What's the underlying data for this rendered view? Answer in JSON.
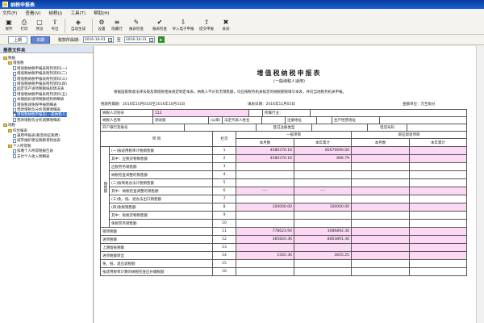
{
  "window": {
    "title": "纳税申报表"
  },
  "menu": [
    "文件(F)",
    "查看(V)",
    "纳税(J)",
    "工具(T)",
    "帮助(H)"
  ],
  "toolbar": [
    {
      "label": "保存",
      "icon": "save-icon",
      "glyph": "▣"
    },
    {
      "label": "打印",
      "icon": "print-icon",
      "glyph": "⎙"
    },
    {
      "label": "预览",
      "icon": "preview-icon",
      "glyph": "▢"
    },
    {
      "label": "导出",
      "icon": "export-icon",
      "glyph": "⇪"
    },
    {
      "label": "自动生成",
      "icon": "auto-generate-icon",
      "glyph": "◈",
      "wide": true
    },
    {
      "label": "设置",
      "icon": "settings-icon",
      "glyph": "⚙"
    },
    {
      "label": "隐藏行",
      "icon": "hide-rows-icon",
      "glyph": "≡"
    },
    {
      "label": "报表检查",
      "icon": "report-check-icon",
      "glyph": "✎",
      "wide": true
    },
    {
      "label": "报表检查",
      "icon": "report-check-2-icon",
      "glyph": "✔",
      "wide": true
    },
    {
      "label": "导入电子申报",
      "icon": "import-icon",
      "glyph": "⇩",
      "wide": true
    },
    {
      "label": "提交申报",
      "icon": "submit-icon",
      "glyph": "⇧",
      "wide": true
    },
    {
      "label": "关闭",
      "icon": "close-icon",
      "glyph": "✖"
    }
  ],
  "datebar": {
    "prev": "上期",
    "current": "本期",
    "period_label": "税款所属期:",
    "start": "2016-10-01",
    "sep": "至",
    "end": "2016-10-31"
  },
  "sidebar": {
    "header": "报表文件夹",
    "items": [
      {
        "label": "税报",
        "level": 0,
        "type": "folder"
      },
      {
        "label": "增值税",
        "level": 1,
        "type": "folder"
      },
      {
        "label": "增值税纳税申报表附列资料(一)",
        "level": 2,
        "type": "doc"
      },
      {
        "label": "增值税纳税申报表附列资料(二)",
        "level": 2,
        "type": "doc"
      },
      {
        "label": "增值税纳税申报表附列资料(三)",
        "level": 2,
        "type": "doc"
      },
      {
        "label": "增值税纳税申报表附列资料(四)",
        "level": 2,
        "type": "doc"
      },
      {
        "label": "固定资产进项税额抵扣情况表",
        "level": 2,
        "type": "doc"
      },
      {
        "label": "增值税纳税申报表附列资料(五)",
        "level": 2,
        "type": "doc"
      },
      {
        "label": "本期抵扣进项税额结构明细表",
        "level": 2,
        "type": "doc"
      },
      {
        "label": "增值税减免税申报明细表",
        "level": 2,
        "type": "doc"
      },
      {
        "label": "营改增税负分析测算明细表",
        "level": 2,
        "type": "doc"
      },
      {
        "label": "增值税纳税申报表(一般纳税人)",
        "level": 2,
        "type": "doc",
        "selected": true
      },
      {
        "label": "营改增税负分析测算明细表",
        "level": 2,
        "type": "doc"
      },
      {
        "label": "地税",
        "level": 0,
        "type": "folder"
      },
      {
        "label": "综合报表",
        "level": 1,
        "type": "folder"
      },
      {
        "label": "通用申报表(税及附征税费)",
        "level": 2,
        "type": "doc"
      },
      {
        "label": "城市维护建设税教育附加表",
        "level": 2,
        "type": "doc"
      },
      {
        "label": "个人所得税",
        "level": 1,
        "type": "folder"
      },
      {
        "label": "扣缴个人所得税报告表",
        "level": 2,
        "type": "doc"
      },
      {
        "label": "支付个人收入明细表",
        "level": 2,
        "type": "doc"
      }
    ]
  },
  "form": {
    "title": "增值税纳税申报表",
    "subtitle": "(一般纳税人适用)",
    "note": "根据国家税收法律法规及增值税相关规定制定本表。纳税人不论有无销售额，均应按税务机关核定的纳税期限填写本表，并向当地税务机关申报。",
    "period": "税款所属期：2016年10月01日至2016年10月31日",
    "fill_date": "填表日期：2016年11月05日",
    "unit": "金额单位：元至角分",
    "taxpayer_id_label": "纳税人识别号",
    "taxpayer_id": "112",
    "industry_label": "所属行业：",
    "name_label": "纳税人名称",
    "name": "测试版",
    "seal": "(公章)",
    "legal_label": "法定代表人姓名",
    "reg_addr_label": "注册地址",
    "prod_addr_label": "生产经营地址",
    "bank_label": "开户银行及账号",
    "reg_type_label": "登记注册类型",
    "phone_label": "电话号码",
    "item_header": "项 目",
    "col_header": "栏次",
    "general_header": "一般项目",
    "immediate_header": "即征即退项目",
    "this_month": "本月数",
    "ytd": "本年累计",
    "section_label": "销售额",
    "rows": [
      {
        "item": "(一)按适用税率计税销售额",
        "col": "1",
        "v1": "4580376.16",
        "v2": "85670690.00",
        "v3": "",
        "v4": ""
      },
      {
        "item": "其中：应税货物销售额",
        "col": "2",
        "v1": "4580376.16",
        "v2": "896.79",
        "v3": "",
        "v4": ""
      },
      {
        "item": "应税劳务销售额",
        "col": "3",
        "v1": "",
        "v2": "",
        "v3": "",
        "v4": ""
      },
      {
        "item": "纳税检查调整的销售额",
        "col": "4",
        "v1": "",
        "v2": "",
        "v3": "",
        "v4": ""
      },
      {
        "item": "(二)按简易办法计税销售额",
        "col": "5",
        "v1": "",
        "v2": "",
        "v3": "",
        "v4": ""
      },
      {
        "item": "其中：纳税检查调整的销售额",
        "col": "6",
        "v1": "----",
        "v2": "----",
        "v3": "",
        "v4": ""
      },
      {
        "item": "(三)免、抵、退办法出口销售额",
        "col": "7",
        "v1": "",
        "v2": "",
        "v3": "",
        "v4": ""
      },
      {
        "item": "(四)免税销售额",
        "col": "8",
        "v1": "100000.00",
        "v2": "100000.00",
        "v3": "",
        "v4": ""
      },
      {
        "item": "其中：免税货物销售额",
        "col": "9",
        "v1": "",
        "v2": "",
        "v3": "",
        "v4": ""
      },
      {
        "item": "免税劳务销售额",
        "col": "10",
        "v1": "",
        "v2": "",
        "v3": "",
        "v4": ""
      },
      {
        "item": "销项税额",
        "col": "11",
        "v1": "778623.94",
        "v2": "3086892.36",
        "v3": "",
        "v4": ""
      },
      {
        "item": "进项税额",
        "col": "12",
        "v1": "385820.36",
        "v2": "8663891.36",
        "v3": "",
        "v4": ""
      },
      {
        "item": "上期留抵税额",
        "col": "13",
        "v1": "",
        "v2": "",
        "v3": "",
        "v4": ""
      },
      {
        "item": "进项税额转出",
        "col": "14",
        "v1": "1565.36",
        "v2": "3655.25",
        "v3": "",
        "v4": ""
      },
      {
        "item": "免、抵、退应退税额",
        "col": "15",
        "v1": "",
        "v2": "",
        "v3": "",
        "v4": ""
      },
      {
        "item": "按适用税率计算的纳税检查应补缴税额",
        "col": "16",
        "v1": "",
        "v2": "",
        "v3": "",
        "v4": ""
      }
    ]
  }
}
